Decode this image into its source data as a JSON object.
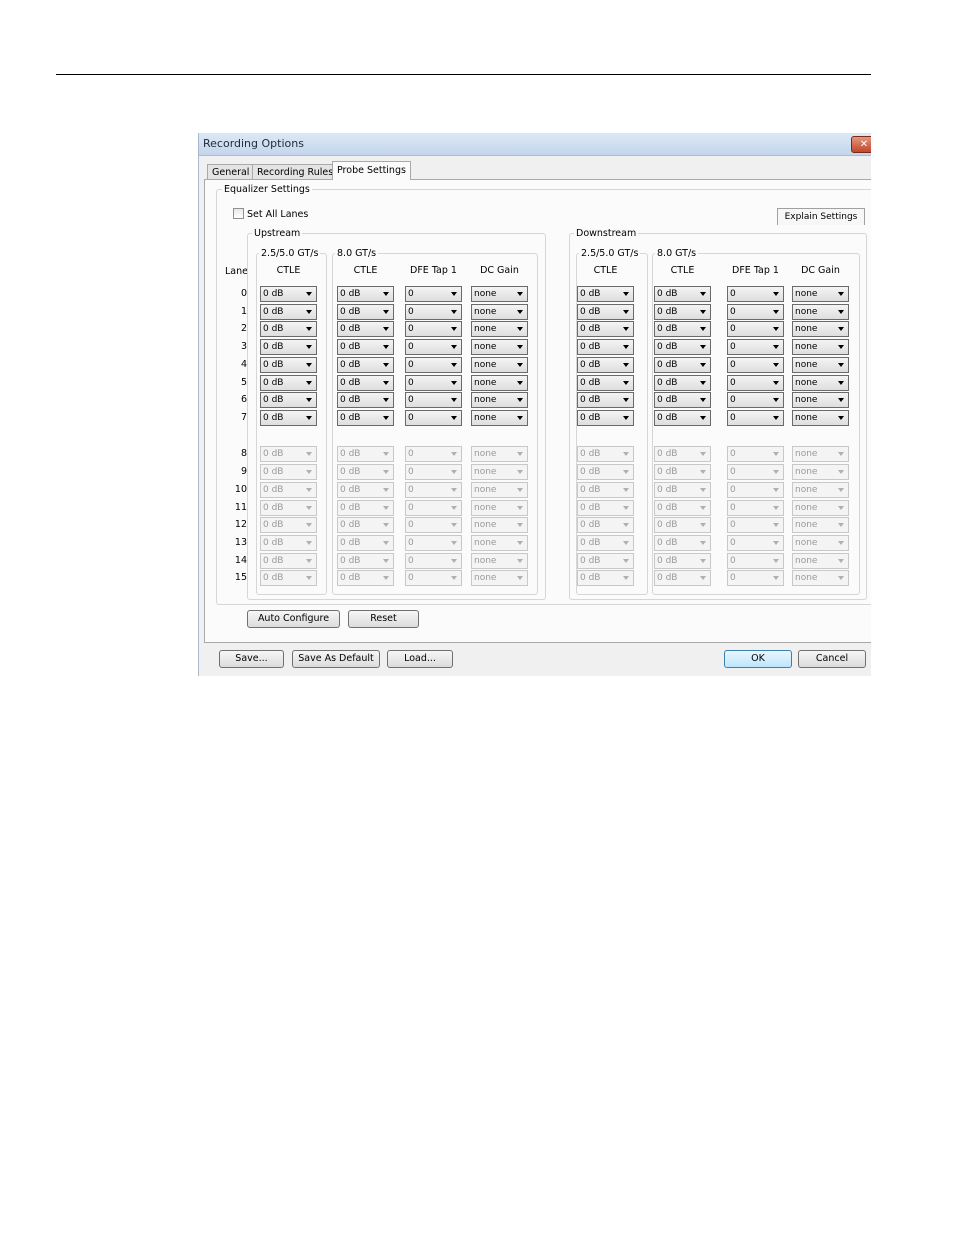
{
  "dialog": {
    "title": "Recording Options",
    "close_glyph": "✕"
  },
  "tabs": [
    {
      "label": "General"
    },
    {
      "label": "Recording Rules"
    },
    {
      "label": "Probe Settings",
      "active": true
    }
  ],
  "equalizer": {
    "legend": "Equalizer Settings",
    "set_all_lanes_label": "Set All Lanes",
    "set_all_lanes_checked": false,
    "explain_button": "Explain Settings",
    "lane_header": "Lane",
    "upstream": {
      "legend": "Upstream",
      "group1_legend": "2.5/5.0 GT/s",
      "group2_legend": "8.0 GT/s",
      "headers": [
        "CTLE",
        "CTLE",
        "DFE Tap 1",
        "DC Gain"
      ]
    },
    "downstream": {
      "legend": "Downstream",
      "group1_legend": "2.5/5.0 GT/s",
      "group2_legend": "8.0 GT/s",
      "headers": [
        "CTLE",
        "CTLE",
        "DFE Tap 1",
        "DC Gain"
      ]
    },
    "lanes": [
      "0",
      "1",
      "2",
      "3",
      "4",
      "5",
      "6",
      "7",
      "8",
      "9",
      "10",
      "11",
      "12",
      "13",
      "14",
      "15"
    ],
    "values": {
      "ctle": "0 dB",
      "dfe": "0",
      "dc_gain": "none"
    },
    "enabled_lane_count": 8
  },
  "buttons": {
    "auto_configure": "Auto Configure",
    "reset": "Reset",
    "save": "Save...",
    "save_default": "Save As Default",
    "load": "Load...",
    "ok": "OK",
    "cancel": "Cancel"
  },
  "icons": {
    "dropdown": "chevron-down-icon",
    "close": "close-icon",
    "checkbox": "checkbox-icon"
  }
}
